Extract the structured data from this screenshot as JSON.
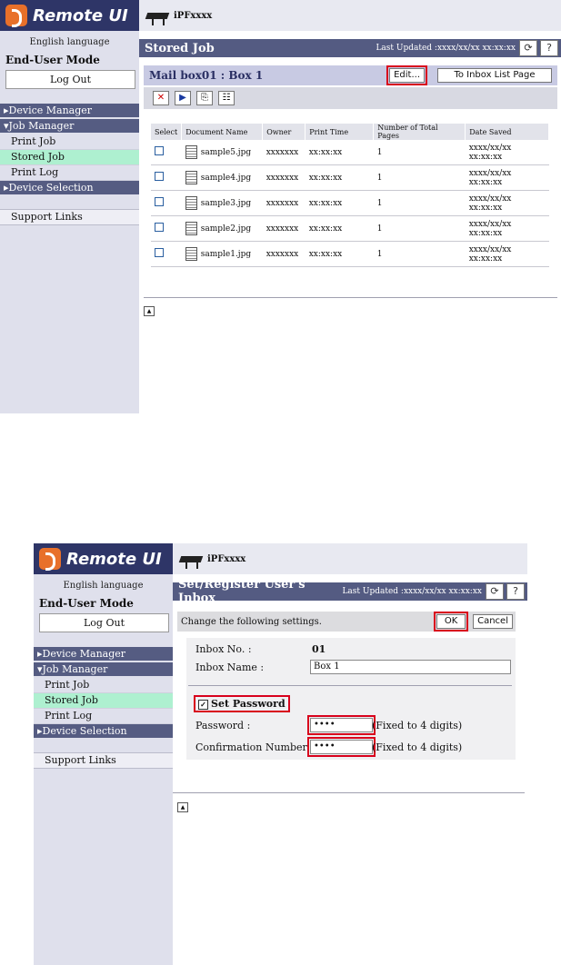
{
  "panel1": {
    "sidebar": {
      "logo_text": "Remote UI",
      "language": "English language",
      "mode": "End-User Mode",
      "logout": "Log Out",
      "device_manager": "▸Device Manager",
      "job_manager": "▾Job Manager",
      "items": [
        "Print Job",
        "Stored Job",
        "Print Log"
      ],
      "device_selection": "▸Device Selection",
      "support_links": "Support Links"
    },
    "model": "iPFxxxx",
    "page_title": "Stored Job",
    "last_updated": "Last Updated :xxxx/xx/xx xx:xx:xx",
    "refresh_icon": "⟳",
    "help_label": "?",
    "box_title": "Mail box01 : Box 1",
    "edit_button": "Edit...",
    "inbox_list_button": "To Inbox List Page",
    "toolbar_icons": [
      "delete-icon",
      "print-icon",
      "move-icon",
      "details-icon"
    ],
    "columns": [
      "Select",
      "Document Name",
      "Owner",
      "Print Time",
      "Number of Total Pages",
      "Date Saved"
    ],
    "rows": [
      {
        "name": "sample5.jpg",
        "owner": "xxxxxxx",
        "time": "xx:xx:xx",
        "pages": "1",
        "saved": "xxxx/xx/xx xx:xx:xx"
      },
      {
        "name": "sample4.jpg",
        "owner": "xxxxxxx",
        "time": "xx:xx:xx",
        "pages": "1",
        "saved": "xxxx/xx/xx xx:xx:xx"
      },
      {
        "name": "sample3.jpg",
        "owner": "xxxxxxx",
        "time": "xx:xx:xx",
        "pages": "1",
        "saved": "xxxx/xx/xx xx:xx:xx"
      },
      {
        "name": "sample2.jpg",
        "owner": "xxxxxxx",
        "time": "xx:xx:xx",
        "pages": "1",
        "saved": "xxxx/xx/xx xx:xx:xx"
      },
      {
        "name": "sample1.jpg",
        "owner": "xxxxxxx",
        "time": "xx:xx:xx",
        "pages": "1",
        "saved": "xxxx/xx/xx xx:xx:xx"
      }
    ]
  },
  "panel2": {
    "sidebar": {
      "logo_text": "Remote UI",
      "language": "English language",
      "mode": "End-User Mode",
      "logout": "Log Out",
      "device_manager": "▸Device Manager",
      "job_manager": "▾Job Manager",
      "items": [
        "Print Job",
        "Stored Job",
        "Print Log"
      ],
      "device_selection": "▸Device Selection",
      "support_links": "Support Links"
    },
    "model": "iPFxxxx",
    "page_title": "Set/Register User's Inbox",
    "last_updated": "Last Updated :xxxx/xx/xx xx:xx:xx",
    "refresh_icon": "⟳",
    "help_label": "?",
    "message": "Change the following settings.",
    "ok_button": "OK",
    "cancel_button": "Cancel",
    "inbox_no_label": "Inbox No. :",
    "inbox_no_value": "01",
    "inbox_name_label": "Inbox Name :",
    "inbox_name_value": "Box 1",
    "set_password_label": "Set Password",
    "set_password_checked": true,
    "password_label": "Password :",
    "password_value": "••••",
    "password_note": "(Fixed to 4 digits)",
    "confirm_label": "Confirmation Number :",
    "confirm_value": "••••",
    "confirm_note": "(Fixed to 4 digits)"
  },
  "colors": {
    "header": "#2e3567",
    "titlebar": "#545b82",
    "active_nav": "#aef0d0",
    "highlight": "#d8001c"
  }
}
